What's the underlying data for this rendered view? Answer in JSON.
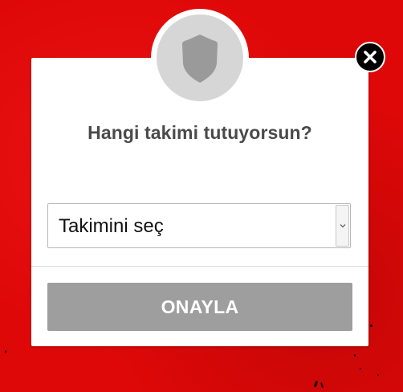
{
  "colors": {
    "background": "#df0808",
    "modal": "#ffffff",
    "badge": "#d6d6d6",
    "shield": "#9a9a9a",
    "question_text": "#4a4a4a",
    "confirm_button": "#9e9e9e",
    "close_button": "#000000"
  },
  "icons": {
    "badge": "shield-icon",
    "close": "close-icon",
    "dropdown": "chevron-down-icon"
  },
  "modal": {
    "question": "Hangi takimi tutuyorsun?",
    "team_select": {
      "selected_value": "Takimini seç"
    },
    "confirm_button_label": "ONAYLA"
  }
}
